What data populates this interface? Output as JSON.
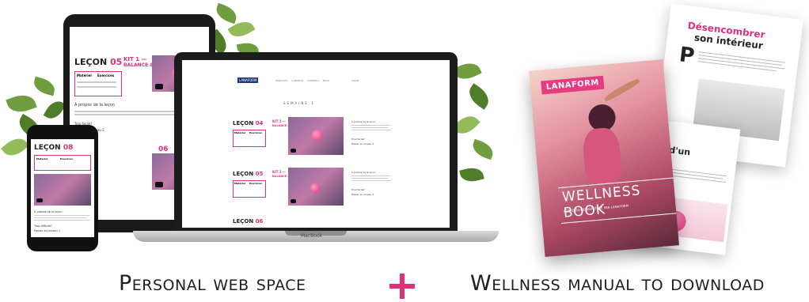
{
  "captions": {
    "left": "Personal web space",
    "right": "Wellness manual to download"
  },
  "colors": {
    "accent": "#e0307a",
    "brand_blue": "#1e3a7a"
  },
  "tablet": {
    "lesson_label": "LEÇON",
    "lesson_num": "05",
    "lesson2_num": "06",
    "col1": "Matériel",
    "col2": "Exercices",
    "kit": "KIT 1 —",
    "kit_sub": "BALANCE & PILATES",
    "about": "À propos de la leçon",
    "too_easy": "Trop facile?",
    "level_link": "Passer au niveau 2"
  },
  "phone": {
    "lesson_label": "LEÇON",
    "lesson_num": "08",
    "col1": "Matériel",
    "col2": "Exercices",
    "about": "À propos de la leçon",
    "too_easy": "Trop difficile?",
    "level_link": "Passer au niveau 1"
  },
  "laptop": {
    "logo": "LANAFORM",
    "nav": [
      "PRODUITS",
      "À PROPOS",
      "CONSEILS",
      "BLOG",
      "LOGIN"
    ],
    "week": "SEMAINE 1",
    "lesson_label": "LEÇON",
    "lessons": [
      "04",
      "05",
      "06"
    ],
    "col1": "Matériel",
    "col2": "Exercices",
    "kit": "KIT 1 —",
    "kit_sub": "BALANCE & PILATES",
    "about": "À propos de la leçon",
    "too_easy": "Trop facile?",
    "level_link": "Passer au niveau 2",
    "brand": "MacBook"
  },
  "book": {
    "cover_logo": "LANAFORM",
    "cover_title": "WELLNESS BOOK",
    "cover_subtitle": "VOTRE GUIDE BIEN-ÊTRE PAR LANAFORM",
    "page_title_1": "Désencombrer",
    "page_title_2": "son intérieur",
    "mid_fragment": "ment d'un"
  }
}
